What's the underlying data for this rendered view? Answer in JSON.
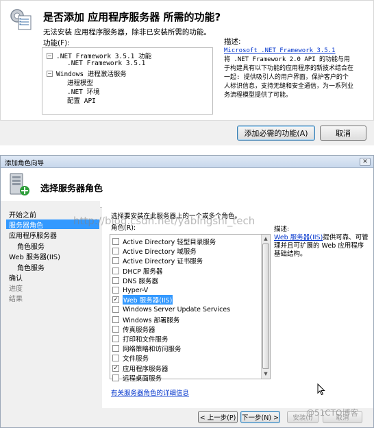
{
  "top_dialog": {
    "title": "是否添加 应用程序服务器 所需的功能?",
    "subtitle": "无法安装 应用程序服务器，除非已安装所需的功能。",
    "features_label": "功能(F):",
    "tree": [
      {
        "label": ".NET Framework 3.5.1 功能",
        "level": 0,
        "toggle": "−"
      },
      {
        "label": ".NET Framework 3.5.1",
        "level": 1
      },
      {
        "label": "Windows 进程激活服务",
        "level": 0,
        "toggle": "−"
      },
      {
        "label": "进程模型",
        "level": 1
      },
      {
        "label": ".NET 环境",
        "level": 1
      },
      {
        "label": "配置 API",
        "level": 1
      }
    ],
    "description_label": "描述:",
    "description_link": "Microsoft .NET Framework 3.5.1",
    "description_text": "将 .NET Framework 2.0 API 的功能与用于构建具有以下功能的应用程序的新技术结合在一起: 提供吸引人的用户界面，保护客户的个人标识信息，支持无缝和安全通信，为一系列业务流程模型提供了可能。",
    "add_button": "添加必需的功能(A)",
    "cancel_button": "取消"
  },
  "wizard": {
    "window_title": "添加角色向导",
    "header_title": "选择服务器角色",
    "nav": [
      {
        "label": "开始之前",
        "state": "normal"
      },
      {
        "label": "服务器角色",
        "state": "selected"
      },
      {
        "label": "应用程序服务器",
        "state": "normal"
      },
      {
        "label": "角色服务",
        "state": "sub"
      },
      {
        "label": "Web 服务器(IIS)",
        "state": "normal"
      },
      {
        "label": "角色服务",
        "state": "sub"
      },
      {
        "label": "确认",
        "state": "normal"
      },
      {
        "label": "进度",
        "state": "dim"
      },
      {
        "label": "结果",
        "state": "dim"
      }
    ],
    "instruction": "选择要安装在此服务器上的一个或多个角色。",
    "roles_label": "角色(R):",
    "roles": [
      {
        "label": "Active Directory 轻型目录服务",
        "checked": false
      },
      {
        "label": "Active Directory 域服务",
        "checked": false
      },
      {
        "label": "Active Directory 证书服务",
        "checked": false
      },
      {
        "label": "DHCP 服务器",
        "checked": false
      },
      {
        "label": "DNS 服务器",
        "checked": false
      },
      {
        "label": "Hyper-V",
        "checked": false
      },
      {
        "label": "Web 服务器(IIS)",
        "checked": true,
        "highlighted": true
      },
      {
        "label": "Windows Server Update Services",
        "checked": false
      },
      {
        "label": "Windows 部署服务",
        "checked": false
      },
      {
        "label": "传真服务器",
        "checked": false
      },
      {
        "label": "打印和文件服务",
        "checked": false
      },
      {
        "label": "网络策略和访问服务",
        "checked": false
      },
      {
        "label": "文件服务",
        "checked": false
      },
      {
        "label": "应用程序服务器",
        "checked": true
      },
      {
        "label": "远程桌面服务",
        "checked": false
      }
    ],
    "description_label": "描述:",
    "description_link": "Web 服务器(IIS)",
    "description_text": "提供可靠、可管理并且可扩展的 Web 应用程序基础结构。",
    "more_info_link": "有关服务器角色的详细信息",
    "prev_button": "< 上一步(P)",
    "next_button": "下一步(N) >",
    "install_button": "安装(I)",
    "cancel_button": "取消",
    "watermark_url": "http://blog.csdn.net/yabingshi_tech",
    "watermark_site": "@51CTO博客"
  }
}
